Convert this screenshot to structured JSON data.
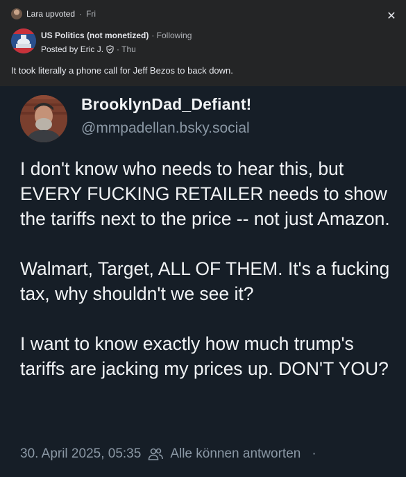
{
  "header": {
    "upvote_user": "Lara upvoted",
    "separator": "·",
    "upvote_time": "Fri",
    "close_symbol": "✕"
  },
  "post": {
    "group_name": "US Politics (not monetized)",
    "following_label": "· Following",
    "posted_by": "Posted by Eric J.",
    "posted_time": "· Thu",
    "text": "It took literally a phone call for Jeff Bezos to back down."
  },
  "embed": {
    "display_name": "BrooklynDad_Defiant!",
    "handle": "@mmpadellan.bsky.social",
    "paragraphs": [
      "I don't know who needs to hear this, but EVERY FUCKING RETAILER needs to show the tariffs next to the price -- not just Amazon.",
      "Walmart, Target, ALL OF THEM. It's a fucking tax, why shouldn't we see it?",
      "I want to know exactly how much trump's tariffs are jacking my prices up. DON'T YOU?"
    ],
    "timestamp": "30. April 2025, 05:35",
    "reply_setting": "Alle können antworten",
    "trailing_dot": "·"
  },
  "colors": {
    "background": "#242526",
    "embed_background": "#161e27",
    "muted_text": "#8b98a5"
  },
  "icons": [
    "close-icon",
    "shield-icon",
    "people-icon"
  ]
}
